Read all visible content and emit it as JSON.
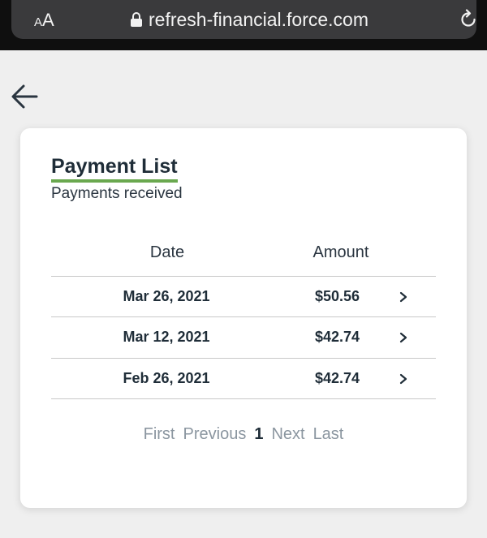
{
  "browser": {
    "aa_label_small": "A",
    "aa_label_large": "A",
    "url": "refresh-financial.force.com"
  },
  "card": {
    "title": "Payment List",
    "subtitle": "Payments received",
    "columns": {
      "date": "Date",
      "amount": "Amount"
    },
    "rows": [
      {
        "date": "Mar 26, 2021",
        "amount": "$50.56"
      },
      {
        "date": "Mar 12, 2021",
        "amount": "$42.74"
      },
      {
        "date": "Feb 26, 2021",
        "amount": "$42.74"
      }
    ],
    "pager": {
      "first": "First",
      "previous": "Previous",
      "current": "1",
      "next": "Next",
      "last": "Last"
    }
  },
  "colors": {
    "accent_underline": "#6aa84f",
    "text_dark": "#1f2d38",
    "pager_muted": "#8b96a0"
  },
  "icons": [
    "lock-icon",
    "reload-icon",
    "back-arrow-icon",
    "chevron-right-icon"
  ]
}
